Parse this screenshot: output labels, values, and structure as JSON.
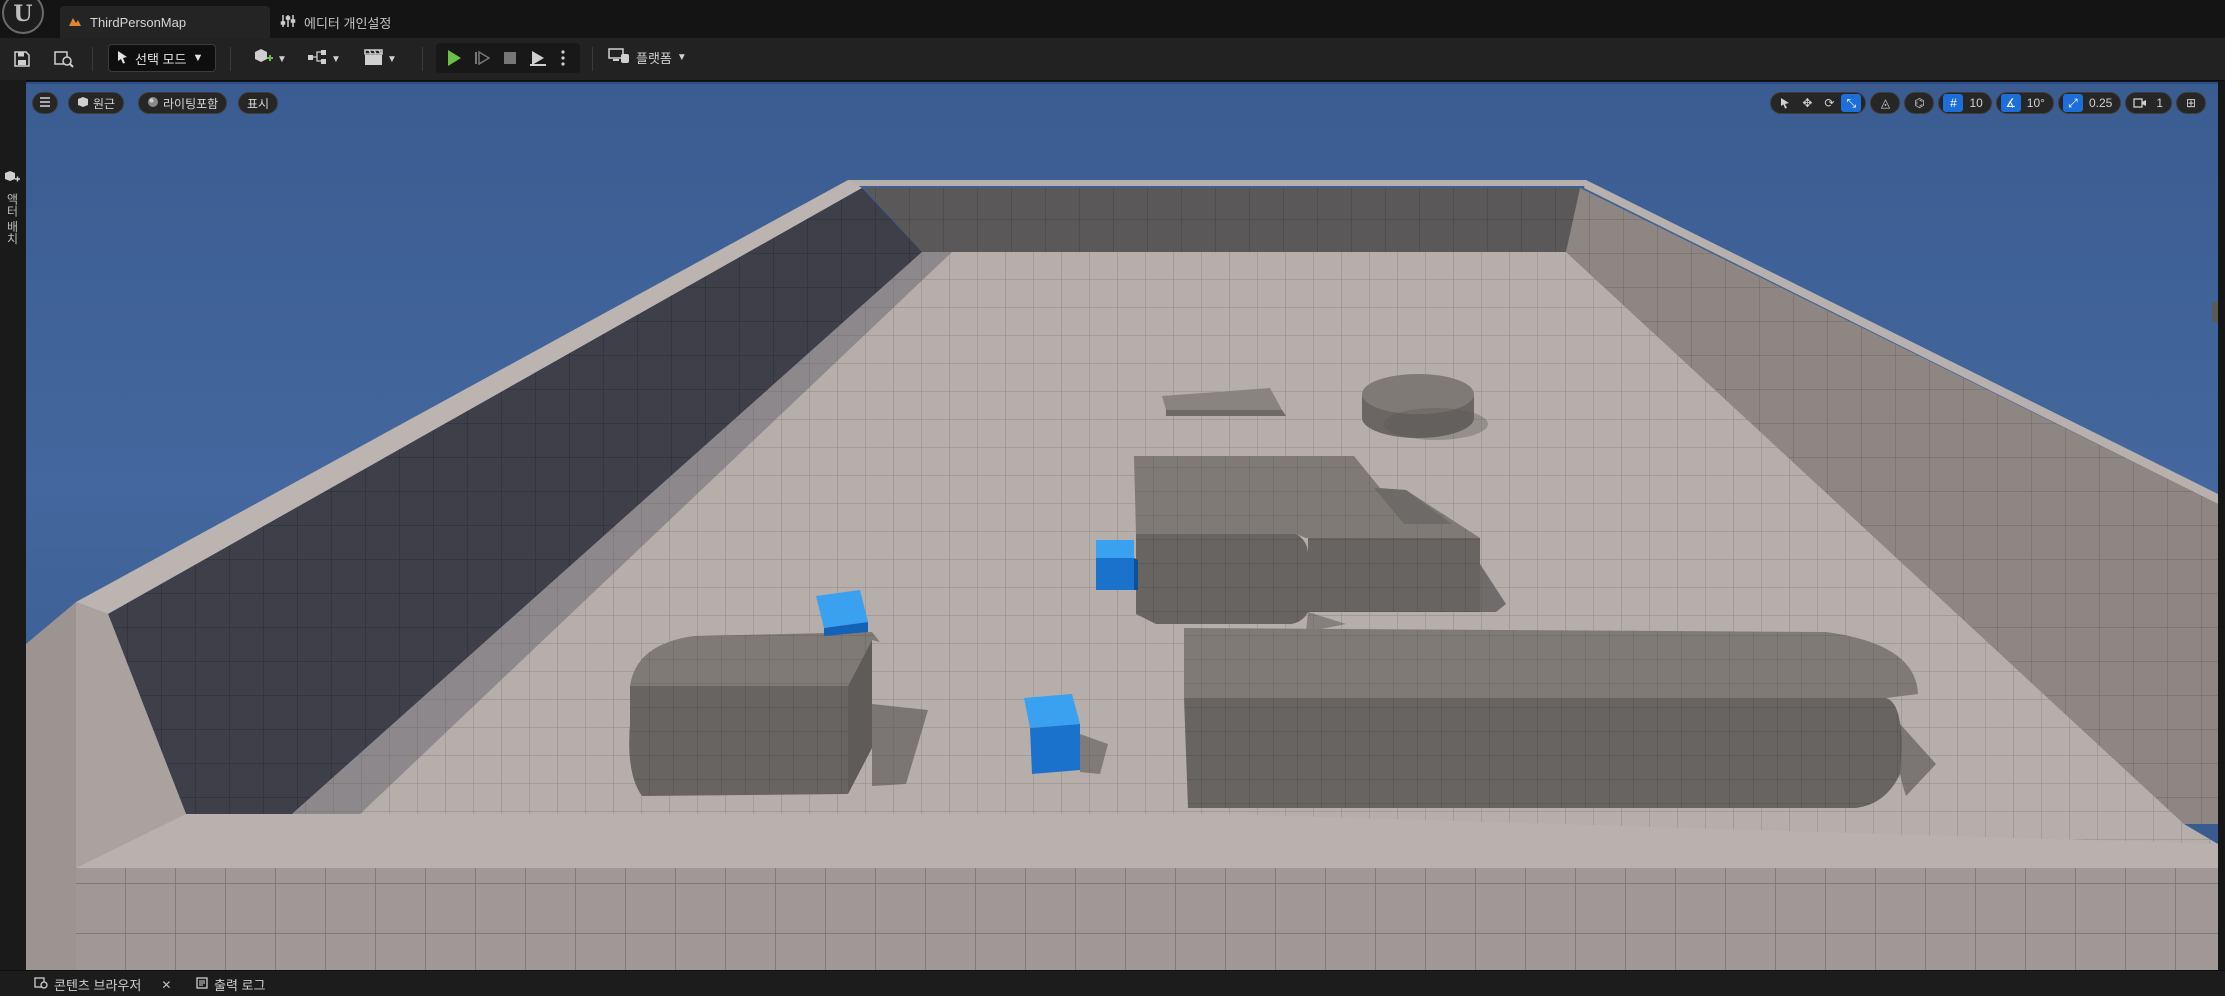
{
  "titlebar": {
    "map_tab": "ThirdPersonMap",
    "prefs_tab": "에디터 개인설정"
  },
  "toolbar": {
    "mode": "선택 모드",
    "platform": "플랫폼"
  },
  "left_panel": {
    "details_tab": "액터 배치"
  },
  "viewport": {
    "perspective_button": "원근",
    "lit_button": "라이팅포함",
    "show_button": "표시",
    "grid_snap": "10",
    "rotate_snap": "10°",
    "scale_snap": "0.25",
    "camera_speed": "1"
  },
  "bottom": {
    "content_browser": "콘텐츠 브라우저",
    "output_log": "출력 로그"
  },
  "colors": {
    "accent": "#1d6ed9",
    "sky": "#43679e",
    "floor": "#b4aca8",
    "wall": "#56555a",
    "block": "#7c7773",
    "cube": "#1f86e0",
    "play_green": "#6cc04a"
  },
  "icons": {
    "save": "save-icon",
    "browse": "content-browse-icon",
    "play": "play-icon",
    "stop": "stop-icon",
    "close": "close-icon"
  }
}
